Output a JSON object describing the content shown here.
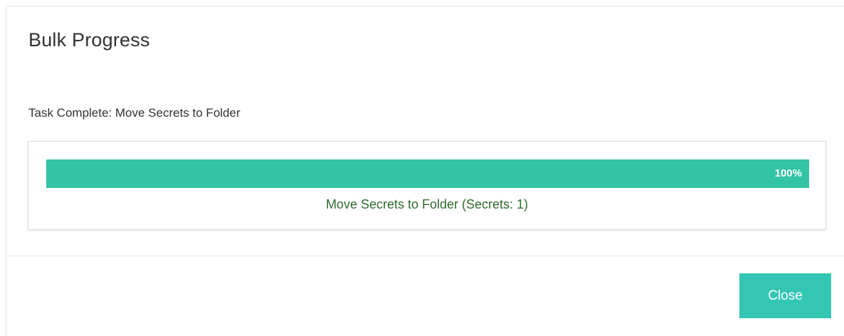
{
  "dialog": {
    "title": "Bulk Progress",
    "task_status": "Task Complete: Move Secrets to Folder",
    "progress": {
      "value": 100,
      "label": "100%",
      "caption": "Move Secrets to Folder (Secrets: 1)",
      "fill_color": "#33c3a5"
    },
    "close_label": "Close"
  },
  "colors": {
    "accent": "#33c6b3",
    "caption_text": "#2e6b2e"
  }
}
